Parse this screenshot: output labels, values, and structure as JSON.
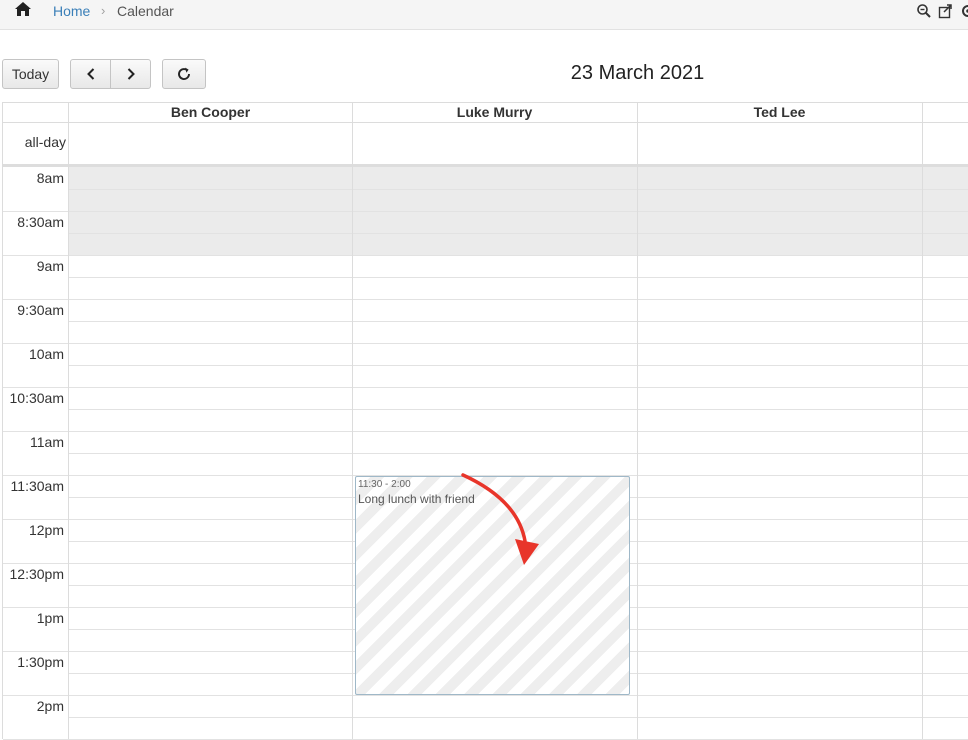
{
  "breadcrumb": {
    "home": "Home",
    "separator": "›",
    "current": "Calendar"
  },
  "toolbar": {
    "today": "Today",
    "prev_icon": "chevron-left-icon",
    "next_icon": "chevron-right-icon",
    "refresh_icon": "refresh-icon"
  },
  "title": "23 March 2021",
  "resources": [
    "Ben Cooper",
    "Luke Murry",
    "Ted Lee"
  ],
  "allday_label": "all-day",
  "times": [
    "8am",
    "8:30am",
    "9am",
    "9:30am",
    "10am",
    "10:30am",
    "11am",
    "11:30am",
    "12pm",
    "12:30pm",
    "1pm",
    "1:30pm",
    "2pm"
  ],
  "event": {
    "time": "11:30 - 2:00",
    "title": "Long lunch with friend",
    "resource": "Luke Murry"
  },
  "colors": {
    "link": "#3a7fb8",
    "annotation_arrow": "#e8352a",
    "event_border": "#9fb8c8",
    "non_business_shade": "#ebebeb"
  },
  "top_icons": [
    "zoom-out-icon",
    "share-icon",
    "settings-icon"
  ]
}
